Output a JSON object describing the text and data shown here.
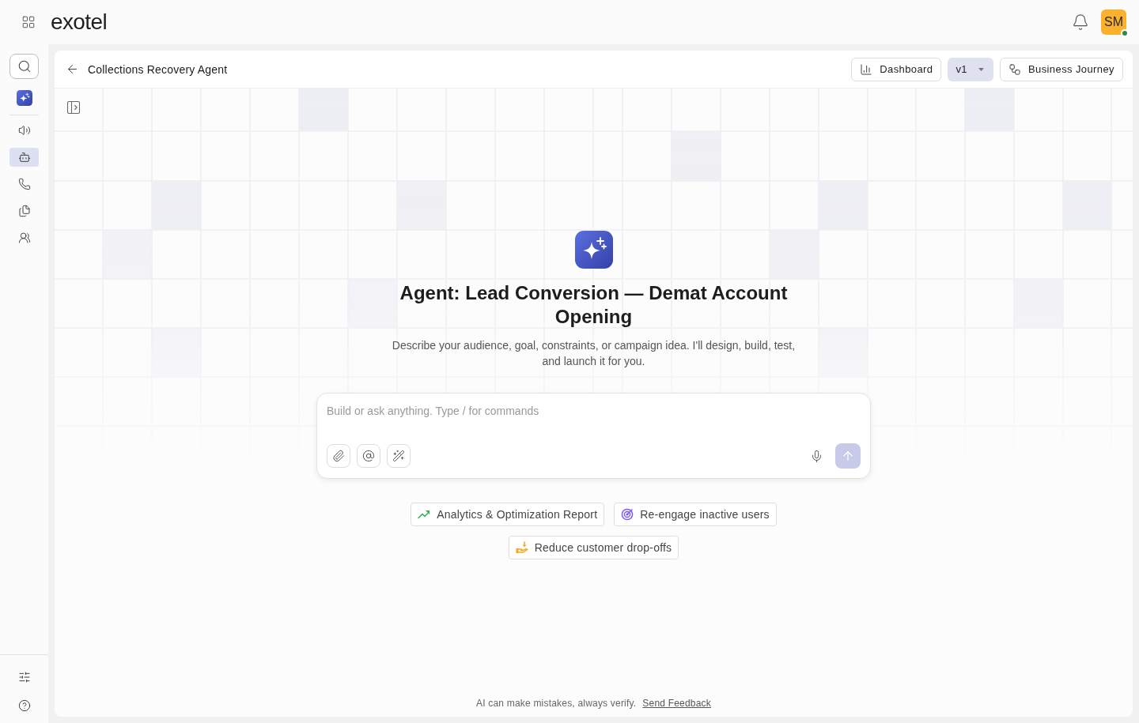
{
  "top_bar": {
    "logo": "exotel",
    "avatar": {
      "initials": "SM",
      "online": true
    }
  },
  "sidebar": {
    "items": [
      {
        "kind": "search",
        "selected": false
      },
      {
        "kind": "tile",
        "selected": false
      },
      {
        "kind": "nav",
        "selected": false
      },
      {
        "kind": "nav",
        "selected": true
      },
      {
        "kind": "nav",
        "selected": false
      },
      {
        "kind": "nav",
        "selected": false
      },
      {
        "kind": "nav",
        "selected": false
      }
    ],
    "bottom_items": [
      {
        "selected": false
      },
      {
        "selected": false
      }
    ]
  },
  "header": {
    "title": "Collections Recovery Agent",
    "actions": [
      {
        "kind": "button",
        "label": "Dashboard"
      },
      {
        "kind": "dropdown",
        "label": "v1"
      },
      {
        "kind": "button",
        "label": "Business Journey"
      }
    ]
  },
  "hero": {
    "title": "Agent: Lead Conversion — Demat Account Opening",
    "description": "Describe your audience, goal, constraints, or campaign idea. I'll design, build, test, and launch it for you."
  },
  "composer": {
    "placeholder": "Build or ask anything. Type / for commands",
    "send_button": {
      "disabled": true
    }
  },
  "suggestions": [
    {
      "label": "Analytics & Optimization Report",
      "color": "#3cb15a"
    },
    {
      "label": "Re-engage inactive users",
      "color": "#7b5cf0"
    },
    {
      "label": "Reduce customer drop-offs",
      "color": "#f5a623"
    }
  ],
  "footer": {
    "note": "AI can make mistakes, always verify.",
    "link": "Send Feedback"
  }
}
